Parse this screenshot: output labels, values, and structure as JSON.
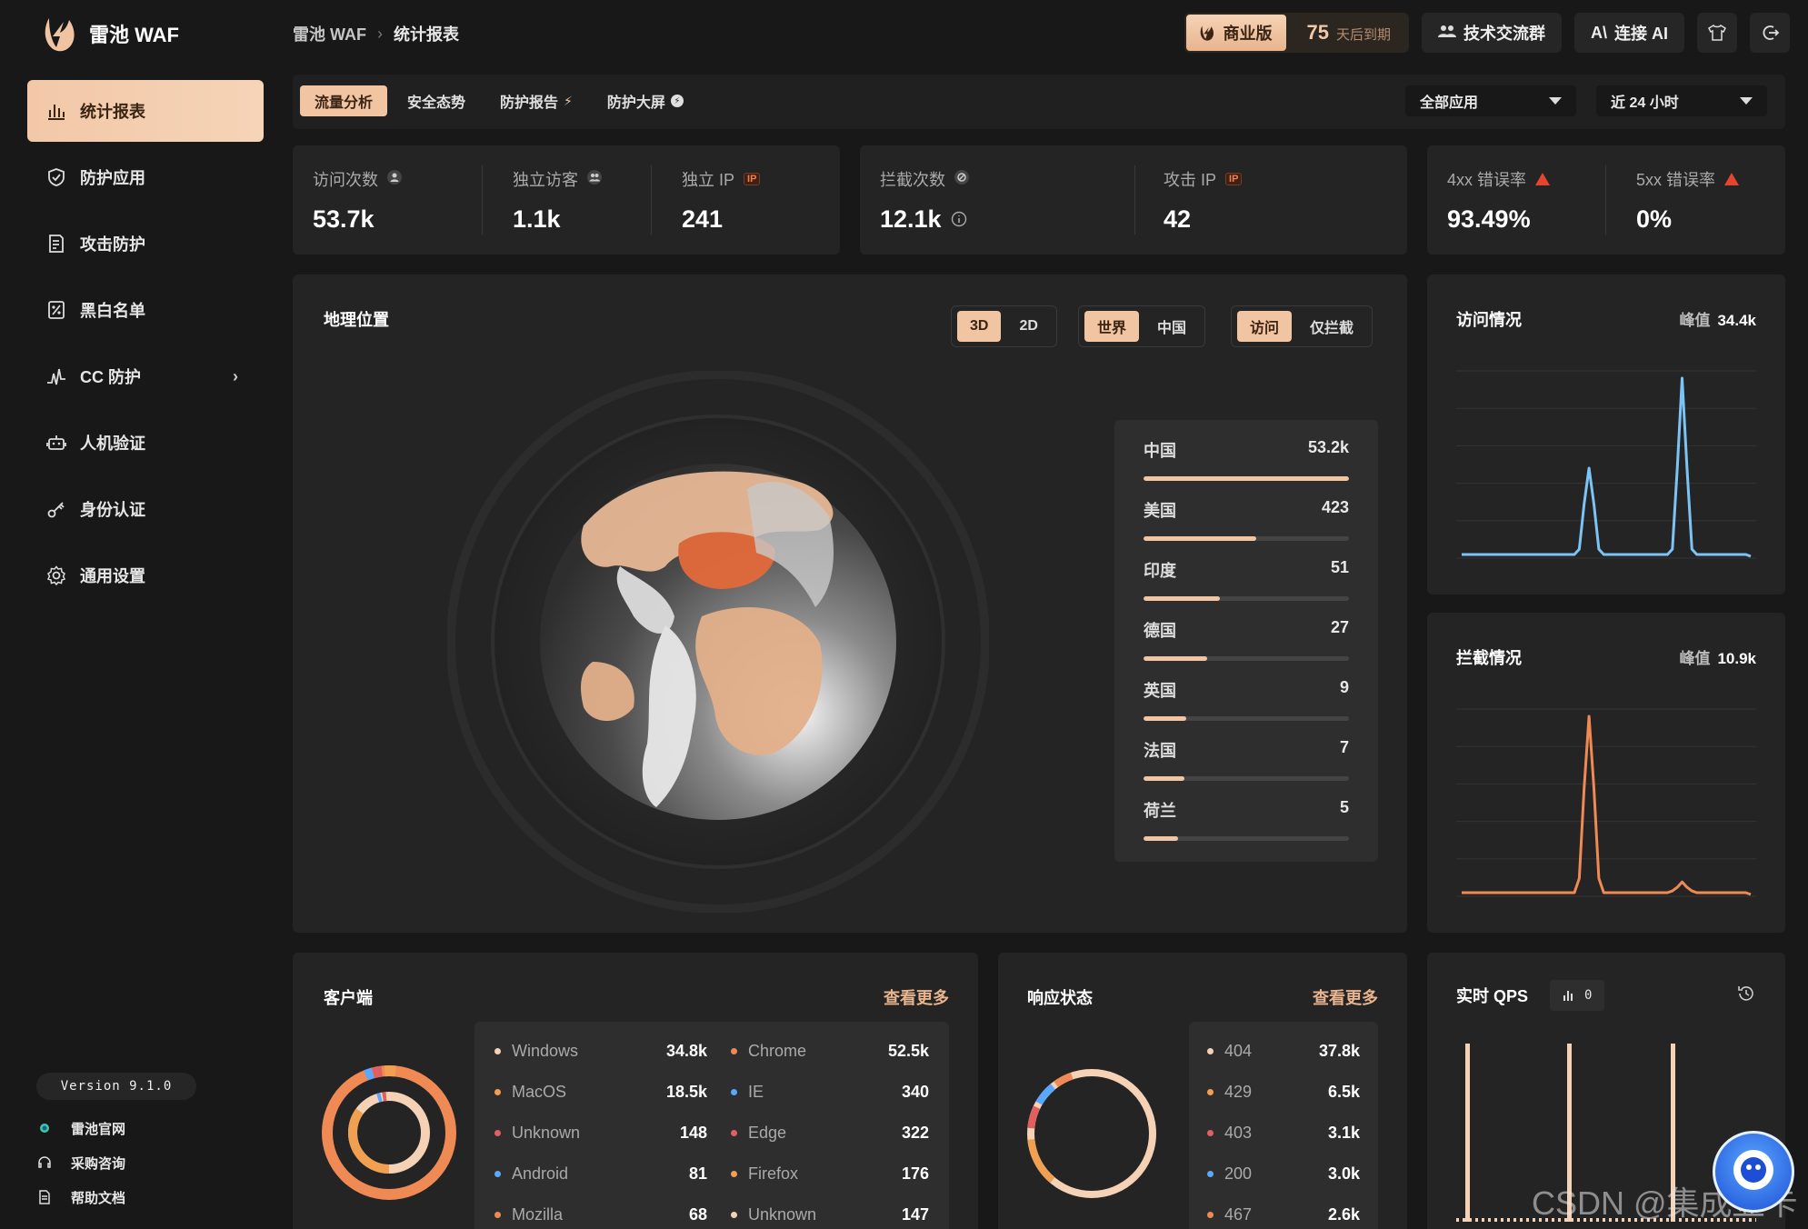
{
  "app": {
    "name": "雷池 WAF"
  },
  "breadcrumb": {
    "root": "雷池 WAF",
    "current": "统计报表"
  },
  "header": {
    "edition": "商业版",
    "days_left": "75",
    "days_suffix": "天后到期",
    "community": "技术交流群",
    "connect_ai": "连接 AI"
  },
  "sidebar": {
    "items": [
      {
        "label": "统计报表",
        "icon": "bar-chart-icon"
      },
      {
        "label": "防护应用",
        "icon": "shield-icon"
      },
      {
        "label": "攻击防护",
        "icon": "document-icon"
      },
      {
        "label": "黑白名单",
        "icon": "percent-icon"
      },
      {
        "label": "CC 防护",
        "icon": "pulse-icon"
      },
      {
        "label": "人机验证",
        "icon": "robot-icon"
      },
      {
        "label": "身份认证",
        "icon": "key-icon"
      },
      {
        "label": "通用设置",
        "icon": "gear-icon"
      }
    ],
    "version": "Version 9.1.0",
    "links": [
      "雷池官网",
      "采购咨询",
      "帮助文档"
    ]
  },
  "tabs": [
    {
      "label": "流量分析"
    },
    {
      "label": "安全态势"
    },
    {
      "label": "防护报告"
    },
    {
      "label": "防护大屏"
    }
  ],
  "filters": {
    "app": "全部应用",
    "range": "近 24 小时"
  },
  "stats": {
    "visits": {
      "label": "访问次数",
      "value": "53.7k"
    },
    "unique_visitors": {
      "label": "独立访客",
      "value": "1.1k"
    },
    "unique_ip": {
      "label": "独立 IP",
      "value": "241"
    },
    "blocked": {
      "label": "拦截次数",
      "value": "12.1k"
    },
    "attack_ip": {
      "label": "攻击 IP",
      "value": "42"
    },
    "err4xx": {
      "label": "4xx 错误率",
      "value": "93.49%"
    },
    "err5xx": {
      "label": "5xx 错误率",
      "value": "0%"
    },
    "ip_badge": "IP"
  },
  "geo": {
    "title": "地理位置",
    "view_modes": [
      "3D",
      "2D"
    ],
    "scopes": [
      "世界",
      "中国"
    ],
    "kinds": [
      "访问",
      "仅拦截"
    ],
    "ranking": [
      {
        "country": "中国",
        "value": "53.2k",
        "ratio": 1.0
      },
      {
        "country": "美国",
        "value": "423",
        "ratio": 0.55
      },
      {
        "country": "印度",
        "value": "51",
        "ratio": 0.37
      },
      {
        "country": "德国",
        "value": "27",
        "ratio": 0.31
      },
      {
        "country": "英国",
        "value": "9",
        "ratio": 0.21
      },
      {
        "country": "法国",
        "value": "7",
        "ratio": 0.2
      },
      {
        "country": "荷兰",
        "value": "5",
        "ratio": 0.17
      }
    ]
  },
  "visit_chart": {
    "title": "访问情况",
    "peak_label": "峰值",
    "peak": "34.4k",
    "color": "#7cc4f5",
    "values": [
      0.02,
      0.02,
      0.02,
      0.02,
      0.02,
      0.02,
      0.02,
      0.02,
      0.02,
      0.02,
      0.02,
      0.02,
      0.02,
      0.02,
      0.02,
      0.02,
      0.02,
      0.02,
      0.02,
      0.02,
      0.02,
      0.02,
      0.02,
      0.02,
      0.05,
      0.3,
      0.5,
      0.3,
      0.05,
      0.02,
      0.02,
      0.02,
      0.02,
      0.02,
      0.02,
      0.02,
      0.02,
      0.02,
      0.02,
      0.02,
      0.02,
      0.02,
      0.02,
      0.05,
      0.5,
      1.0,
      0.5,
      0.05,
      0.02,
      0.02,
      0.02,
      0.02,
      0.02,
      0.02,
      0.02,
      0.02,
      0.02,
      0.02,
      0.02,
      0.01
    ]
  },
  "block_chart": {
    "title": "拦截情况",
    "peak_label": "峰值",
    "peak": "10.9k",
    "color": "#f08a55",
    "values": [
      0.02,
      0.02,
      0.02,
      0.02,
      0.02,
      0.02,
      0.02,
      0.02,
      0.02,
      0.02,
      0.02,
      0.02,
      0.02,
      0.02,
      0.02,
      0.02,
      0.02,
      0.02,
      0.02,
      0.02,
      0.02,
      0.02,
      0.02,
      0.02,
      0.1,
      0.6,
      1.0,
      0.6,
      0.1,
      0.02,
      0.02,
      0.02,
      0.02,
      0.02,
      0.02,
      0.02,
      0.02,
      0.02,
      0.02,
      0.02,
      0.02,
      0.02,
      0.02,
      0.03,
      0.05,
      0.08,
      0.05,
      0.03,
      0.02,
      0.02,
      0.02,
      0.02,
      0.02,
      0.02,
      0.02,
      0.02,
      0.02,
      0.02,
      0.02,
      0.01
    ]
  },
  "clients": {
    "title": "客户端",
    "more": "查看更多",
    "os": [
      {
        "name": "Windows",
        "value": "34.8k",
        "color": "#f5d1b5"
      },
      {
        "name": "MacOS",
        "value": "18.5k",
        "color": "#f0a050"
      },
      {
        "name": "Unknown",
        "value": "148",
        "color": "#e06060"
      },
      {
        "name": "Android",
        "value": "81",
        "color": "#5aa7ff"
      },
      {
        "name": "Mozilla",
        "value": "68",
        "color": "#f08a55"
      }
    ],
    "browsers": [
      {
        "name": "Chrome",
        "value": "52.5k",
        "color": "#f08a55"
      },
      {
        "name": "IE",
        "value": "340",
        "color": "#5aa7ff"
      },
      {
        "name": "Edge",
        "value": "322",
        "color": "#e06060"
      },
      {
        "name": "Firefox",
        "value": "176",
        "color": "#f0a050"
      },
      {
        "name": "Unknown",
        "value": "147",
        "color": "#f5d1b5"
      }
    ]
  },
  "responses": {
    "title": "响应状态",
    "more": "查看更多",
    "items": [
      {
        "code": "404",
        "value": "37.8k",
        "color": "#f5d1b5"
      },
      {
        "code": "429",
        "value": "6.5k",
        "color": "#f0a050"
      },
      {
        "code": "403",
        "value": "3.1k",
        "color": "#e06060"
      },
      {
        "code": "200",
        "value": "3.0k",
        "color": "#5aa7ff"
      },
      {
        "code": "467",
        "value": "2.6k",
        "color": "#f08a55"
      }
    ]
  },
  "qps": {
    "title": "实时 QPS",
    "value": "0"
  },
  "watermark": "CSDN @集成显卡"
}
